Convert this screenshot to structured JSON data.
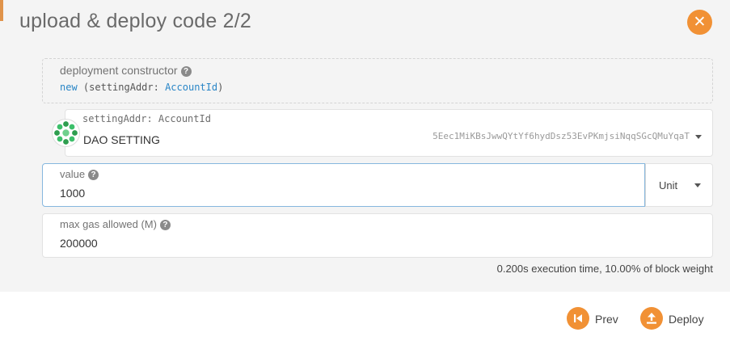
{
  "modal": {
    "title": "upload & deploy code 2/2",
    "close_icon": "close-icon",
    "accent_color": "#f19135"
  },
  "constructor": {
    "label": "deployment constructor",
    "help_icon": "question-icon",
    "keyword": "new",
    "sig_open": "(settingAddr: ",
    "param_type": "AccountId",
    "sig_close": ")"
  },
  "account": {
    "label": "settingAddr: AccountId",
    "name": "DAO SETTING",
    "address": "5Eec1MiKBsJwwQYtYf6hydDsz53EvPKmjsiNqqSGcQMuYqaT",
    "identicon": "identicon",
    "dropdown_icon": "chevron-down-icon"
  },
  "value_field": {
    "label": "value",
    "help_icon": "question-icon",
    "value": "1000",
    "unit": "Unit",
    "unit_dropdown_icon": "chevron-down-icon"
  },
  "gas_field": {
    "label": "max gas allowed (M)",
    "help_icon": "question-icon",
    "value": "200000"
  },
  "exec_info": "0.200s execution time, 10.00% of block weight",
  "footer": {
    "prev_label": "Prev",
    "prev_icon": "skip-back-icon",
    "deploy_label": "Deploy",
    "deploy_icon": "upload-icon"
  }
}
